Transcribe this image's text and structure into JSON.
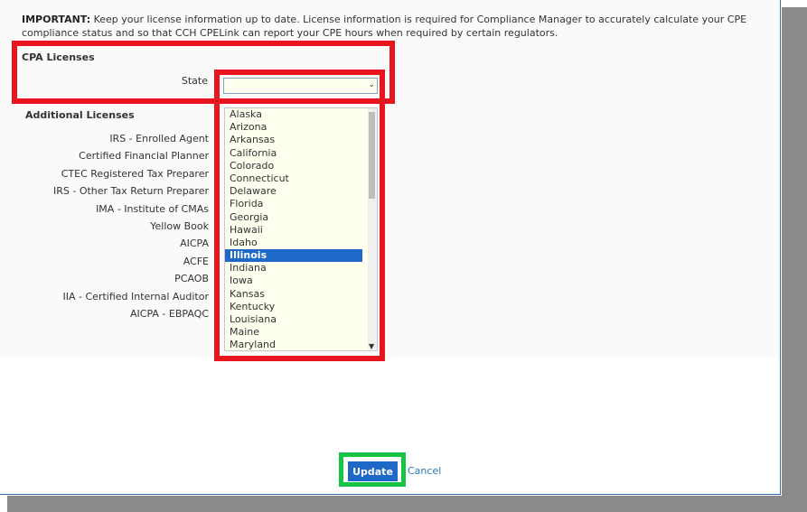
{
  "important": {
    "label": "IMPORTANT:",
    "text": " Keep your license information up to date. License information is required for Compliance Manager to accurately calculate your CPE compliance status and so that CCH CPELink can report your CPE hours when required by certain regulators."
  },
  "cpa_licenses": {
    "heading": "CPA Licenses",
    "state_label": "State",
    "state_value": ""
  },
  "state_options": [
    "Alaska",
    "Arizona",
    "Arkansas",
    "California",
    "Colorado",
    "Connecticut",
    "Delaware",
    "Florida",
    "Georgia",
    "Hawaii",
    "Idaho",
    "Illinois",
    "Indiana",
    "Iowa",
    "Kansas",
    "Kentucky",
    "Louisiana",
    "Maine",
    "Maryland"
  ],
  "selected_state": "Illinois",
  "additional_licenses": {
    "heading": "Additional Licenses",
    "items": [
      "IRS - Enrolled Agent",
      "Certified Financial Planner",
      "CTEC Registered Tax Preparer",
      "IRS - Other Tax Return Preparer",
      "IMA - Institute of CMAs",
      "Yellow Book",
      "AICPA",
      "ACFE",
      "PCAOB",
      "IIA - Certified Internal Auditor",
      "AICPA - EBPAQC"
    ]
  },
  "actions": {
    "update_label": "Update",
    "cancel_label": "Cancel"
  },
  "colors": {
    "highlight_red": "#e8141e",
    "highlight_green": "#17c343",
    "selected_option": "#1e69c8",
    "listbox_bg": "#fffff0"
  }
}
